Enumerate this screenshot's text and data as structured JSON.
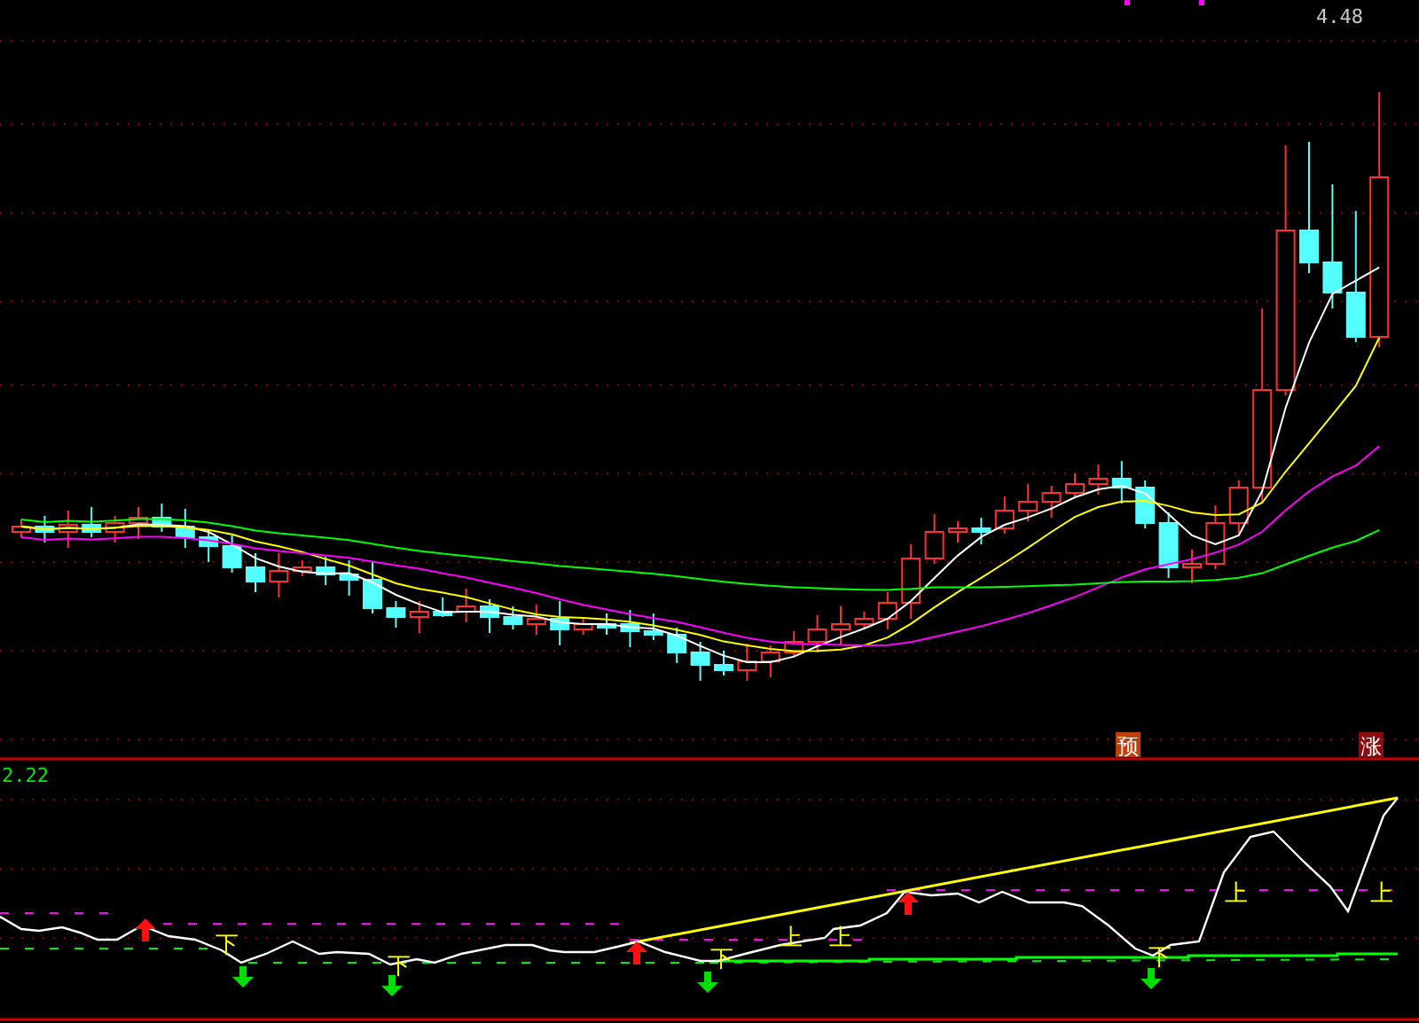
{
  "price_chart": {
    "high_label": "4.48",
    "signals": [
      {
        "text": "预",
        "kind": "forecast"
      },
      {
        "text": "涨",
        "kind": "rise"
      }
    ]
  },
  "indicator": {
    "value_label": "2.22",
    "markers": [
      {
        "text": "下"
      },
      {
        "text": "下"
      },
      {
        "text": "下"
      },
      {
        "text": "上"
      },
      {
        "text": "上"
      },
      {
        "text": "下"
      },
      {
        "text": "上"
      },
      {
        "text": "上"
      }
    ]
  }
}
